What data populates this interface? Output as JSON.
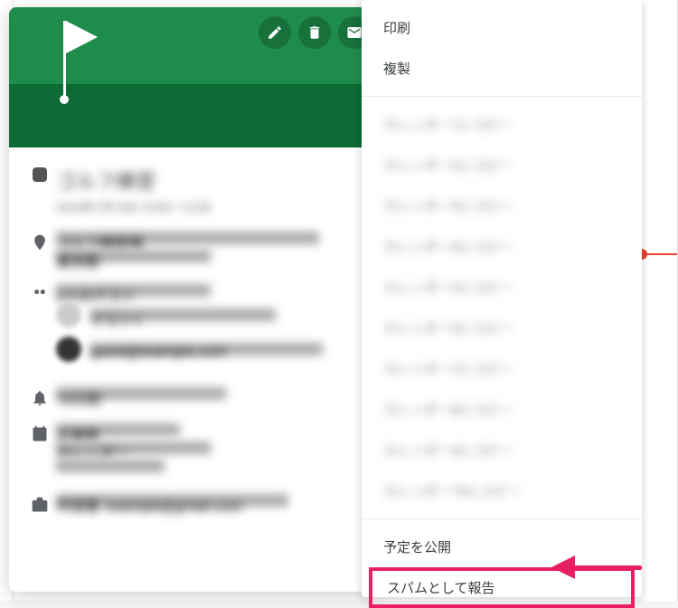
{
  "event": {
    "title": "ゴルフ練習",
    "datetime": "2024年1月15日 10:00〜12:00",
    "location_primary": "ゴルフ練習場",
    "location_secondary": "東京都",
    "guests_header": "2人のゲスト",
    "guest1": "ゲスト1",
    "guest2": "guest@example.com",
    "notification": "10分前",
    "organizer_name": "主催者",
    "organizer_calendar": "カレンダー",
    "creator": "作成者: example@gmail.com"
  },
  "menu": {
    "print": "印刷",
    "duplicate": "複製",
    "copy_to_1": "カレンダー1にコピー",
    "copy_to_2": "カレンダー2にコピー",
    "copy_to_3": "カレンダー3にコピー",
    "copy_to_4": "カレンダー4にコピー",
    "copy_to_5": "カレンダー5にコピー",
    "copy_to_6": "カレンダー6にコピー",
    "copy_to_7": "カレンダー7にコピー",
    "copy_to_8": "カレンダー8にコピー",
    "copy_to_9": "カレンダー9にコピー",
    "copy_to_10": "カレンダー10にコピー",
    "publish": "予定を公開",
    "report_spam": "スパムとして報告"
  },
  "colors": {
    "accent_green": "#1e8c4a",
    "highlight_pink": "#e91e63"
  }
}
